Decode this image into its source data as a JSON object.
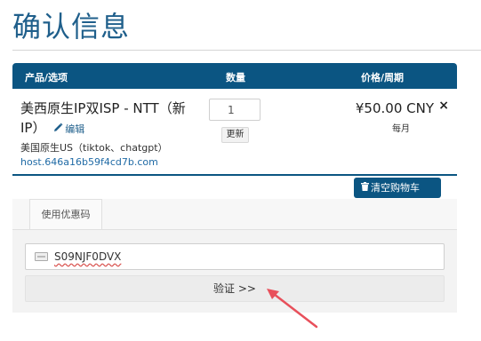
{
  "page": {
    "title": "确认信息"
  },
  "cart": {
    "headers": {
      "product": "产品/选项",
      "quantity": "数量",
      "price": "价格/周期"
    },
    "item": {
      "name": "美西原生IP双ISP - NTT（新IP）",
      "edit_label": "编辑",
      "description": "美国原生US（tiktok、chatgpt）",
      "hostname": "host.646a16b59f4cd7b.com",
      "quantity": "1",
      "update_label": "更新",
      "price": "¥50.00 CNY",
      "cycle": "每月",
      "remove_symbol": "×"
    },
    "empty_cart_label": "清空购物车"
  },
  "promo": {
    "tab_label": "使用优惠码",
    "coupon_value": "S09NJF0DVX",
    "validate_label": "验证 >>"
  },
  "colors": {
    "accent": "#0b5582",
    "title": "#1f5f8b",
    "arrow": "#e8505b"
  },
  "icons": [
    "pencil-icon",
    "trash-icon",
    "ticket-icon",
    "close-icon",
    "arrow-annotation"
  ]
}
